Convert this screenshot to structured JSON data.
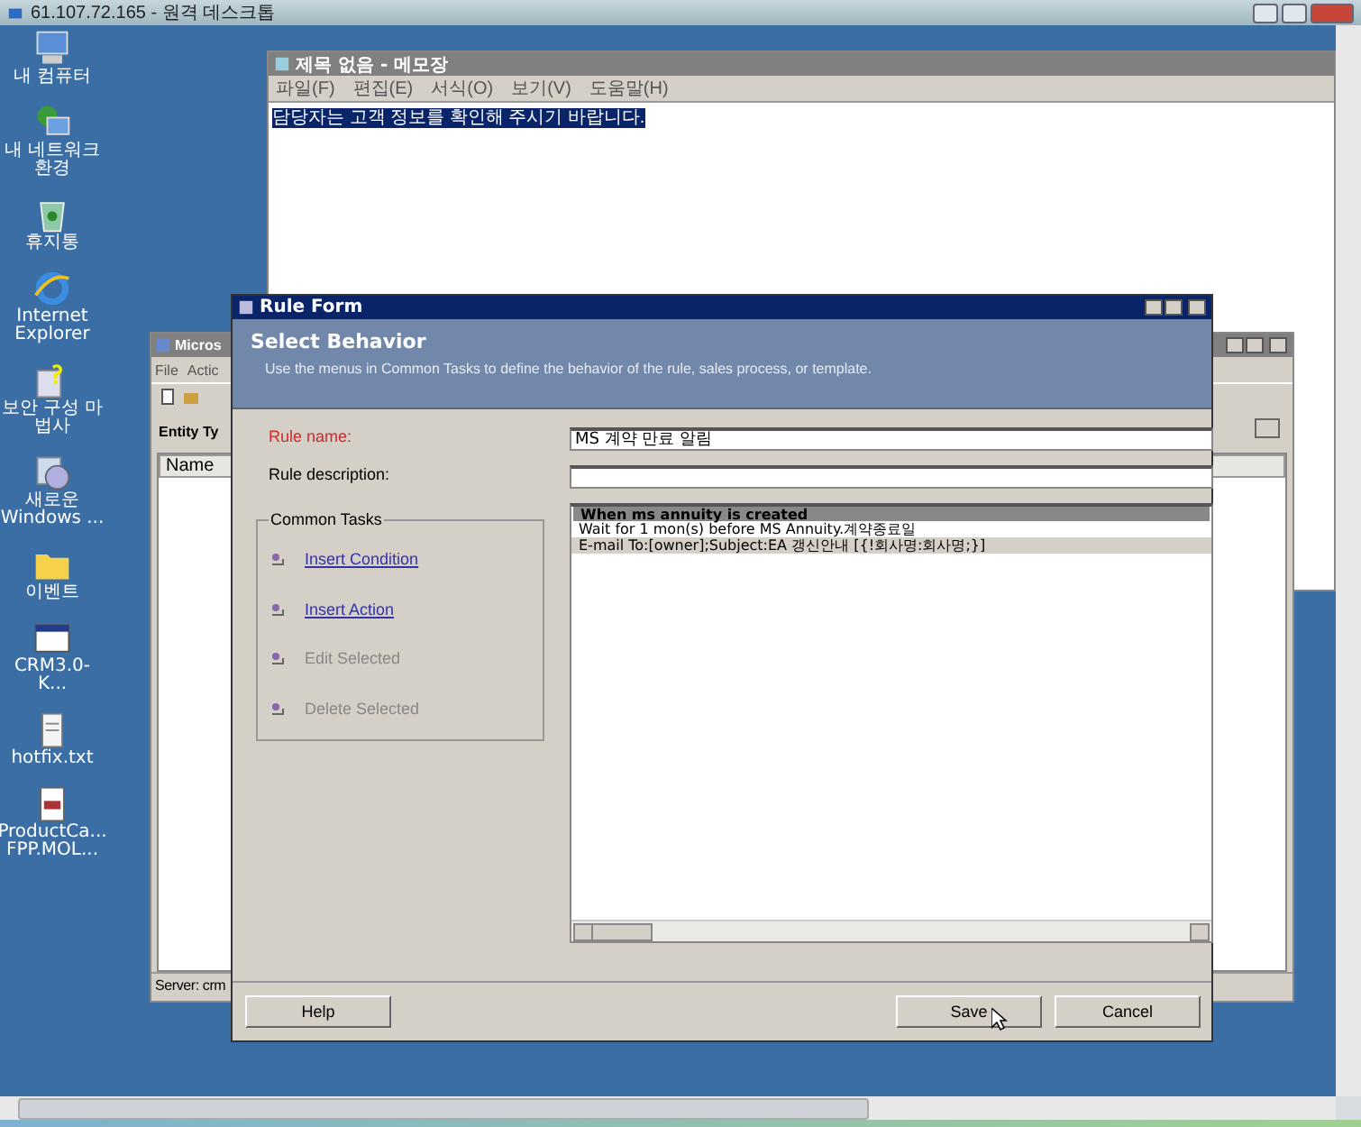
{
  "remote_desktop": {
    "title": "61.107.72.165 - 원격 데스크톱"
  },
  "desktop_icons": [
    {
      "label": "내 컴퓨터"
    },
    {
      "label": "내 네트워크 환경"
    },
    {
      "label": "휴지통"
    },
    {
      "label": "Internet Explorer"
    },
    {
      "label": "보안 구성 마법사"
    },
    {
      "label": "새로운 Windows ..."
    },
    {
      "label": "이벤트"
    },
    {
      "label": "CRM3.0-K..."
    },
    {
      "label": "hotfix.txt"
    },
    {
      "label": "ProductCa... FPP.MOL..."
    }
  ],
  "notepad": {
    "title": "제목 없음 - 메모장",
    "menu": [
      "파일(F)",
      "편집(E)",
      "서식(O)",
      "보기(V)",
      "도움말(H)"
    ],
    "text": "담당자는 고객 정보를 확인해 주시기 바랍니다."
  },
  "crm_window": {
    "title": "Micros",
    "menu": [
      "File",
      "Actic"
    ],
    "entity_label": "Entity Ty",
    "column": "Name",
    "status": "Server: crm"
  },
  "rule_form": {
    "title": "Rule Form",
    "header_title": "Select Behavior",
    "header_description": "Use the menus in Common Tasks to define the behavior of the rule, sales process, or template.",
    "rule_name_label": "Rule name:",
    "rule_name_value": "MS 계약 만료 알림",
    "rule_description_label": "Rule description:",
    "common_tasks": {
      "legend": "Common Tasks",
      "items": [
        {
          "label": "Insert Condition",
          "disabled": false
        },
        {
          "label": "Insert Action",
          "disabled": false
        },
        {
          "label": "Edit Selected",
          "disabled": true
        },
        {
          "label": "Delete Selected",
          "disabled": true
        }
      ]
    },
    "steps": [
      {
        "kind": "header",
        "text": "When ms annuity is created",
        "selected": false
      },
      {
        "kind": "step",
        "text": "Wait for 1 mon(s) before MS Annuity.계약종료일",
        "selected": false
      },
      {
        "kind": "step",
        "text": "E-mail To:[owner];Subject:EA 갱신안내 [{!회사명:회사명;}]",
        "selected": true
      }
    ],
    "buttons": {
      "help": "Help",
      "save": "Save",
      "cancel": "Cancel"
    }
  }
}
